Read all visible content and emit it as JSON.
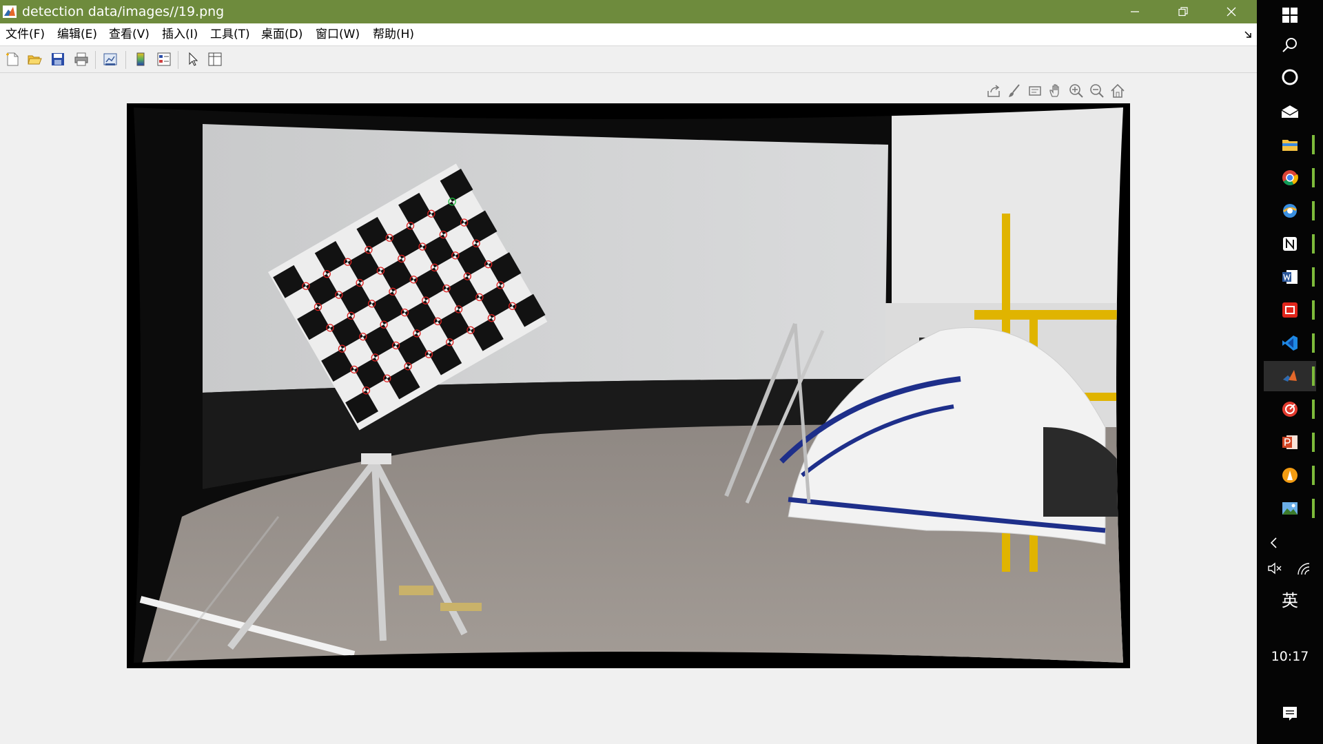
{
  "window": {
    "title": "detection data/images//19.png",
    "titlebar_color": "#6e8b3d"
  },
  "menubar": {
    "items": [
      {
        "label": "文件(F)"
      },
      {
        "label": "编辑(E)"
      },
      {
        "label": "查看(V)"
      },
      {
        "label": "插入(I)"
      },
      {
        "label": "工具(T)"
      },
      {
        "label": "桌面(D)"
      },
      {
        "label": "窗口(W)"
      },
      {
        "label": "帮助(H)"
      }
    ]
  },
  "toolbar": {
    "buttons": [
      "new-figure-icon",
      "open-icon",
      "save-icon",
      "print-icon",
      "link-plot-icon",
      "colorbar-icon",
      "legend-icon",
      "edit-plot-arrow-icon",
      "property-inspector-icon"
    ]
  },
  "axes_toolbar": {
    "buttons": [
      "export-icon",
      "brush-icon",
      "datatip-icon",
      "pan-hand-icon",
      "zoom-in-icon",
      "zoom-out-icon",
      "home-icon"
    ]
  },
  "figure": {
    "content": "undistorted camera image: checkerboard calibration target on tripod, white driving simulator cockpit, curved projection screen",
    "corner_marker_color": "#e02020",
    "origin_marker_color": "#20c040"
  },
  "taskbar": {
    "icons": [
      "windows-start-icon",
      "search-icon",
      "cortana-icon",
      "mail-icon",
      "file-explorer-icon",
      "chrome-icon",
      "browser-icon",
      "notion-icon",
      "word-icon",
      "youdao-icon",
      "vscode-icon",
      "matlab-icon",
      "media-icon",
      "powerpoint-icon",
      "app-icon",
      "photo-viewer-icon"
    ],
    "ime_label": "英",
    "clock": "10:17"
  }
}
